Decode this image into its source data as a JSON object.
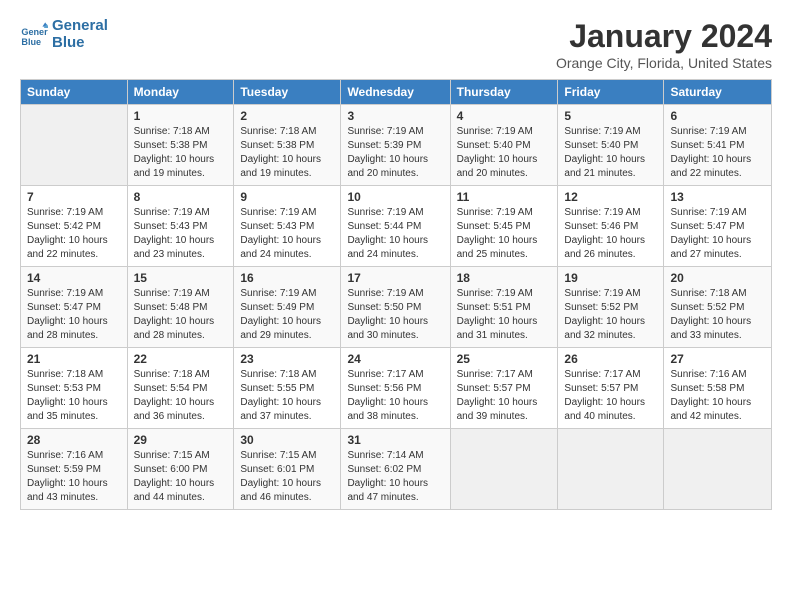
{
  "logo": {
    "text_general": "General",
    "text_blue": "Blue"
  },
  "title": "January 2024",
  "subtitle": "Orange City, Florida, United States",
  "days_of_week": [
    "Sunday",
    "Monday",
    "Tuesday",
    "Wednesday",
    "Thursday",
    "Friday",
    "Saturday"
  ],
  "weeks": [
    [
      {
        "day": "",
        "empty": true
      },
      {
        "day": "1",
        "sunrise": "7:18 AM",
        "sunset": "5:38 PM",
        "daylight": "10 hours and 19 minutes."
      },
      {
        "day": "2",
        "sunrise": "7:18 AM",
        "sunset": "5:38 PM",
        "daylight": "10 hours and 19 minutes."
      },
      {
        "day": "3",
        "sunrise": "7:19 AM",
        "sunset": "5:39 PM",
        "daylight": "10 hours and 20 minutes."
      },
      {
        "day": "4",
        "sunrise": "7:19 AM",
        "sunset": "5:40 PM",
        "daylight": "10 hours and 20 minutes."
      },
      {
        "day": "5",
        "sunrise": "7:19 AM",
        "sunset": "5:40 PM",
        "daylight": "10 hours and 21 minutes."
      },
      {
        "day": "6",
        "sunrise": "7:19 AM",
        "sunset": "5:41 PM",
        "daylight": "10 hours and 22 minutes."
      }
    ],
    [
      {
        "day": "7",
        "sunrise": "7:19 AM",
        "sunset": "5:42 PM",
        "daylight": "10 hours and 22 minutes."
      },
      {
        "day": "8",
        "sunrise": "7:19 AM",
        "sunset": "5:43 PM",
        "daylight": "10 hours and 23 minutes."
      },
      {
        "day": "9",
        "sunrise": "7:19 AM",
        "sunset": "5:43 PM",
        "daylight": "10 hours and 24 minutes."
      },
      {
        "day": "10",
        "sunrise": "7:19 AM",
        "sunset": "5:44 PM",
        "daylight": "10 hours and 24 minutes."
      },
      {
        "day": "11",
        "sunrise": "7:19 AM",
        "sunset": "5:45 PM",
        "daylight": "10 hours and 25 minutes."
      },
      {
        "day": "12",
        "sunrise": "7:19 AM",
        "sunset": "5:46 PM",
        "daylight": "10 hours and 26 minutes."
      },
      {
        "day": "13",
        "sunrise": "7:19 AM",
        "sunset": "5:47 PM",
        "daylight": "10 hours and 27 minutes."
      }
    ],
    [
      {
        "day": "14",
        "sunrise": "7:19 AM",
        "sunset": "5:47 PM",
        "daylight": "10 hours and 28 minutes."
      },
      {
        "day": "15",
        "sunrise": "7:19 AM",
        "sunset": "5:48 PM",
        "daylight": "10 hours and 28 minutes."
      },
      {
        "day": "16",
        "sunrise": "7:19 AM",
        "sunset": "5:49 PM",
        "daylight": "10 hours and 29 minutes."
      },
      {
        "day": "17",
        "sunrise": "7:19 AM",
        "sunset": "5:50 PM",
        "daylight": "10 hours and 30 minutes."
      },
      {
        "day": "18",
        "sunrise": "7:19 AM",
        "sunset": "5:51 PM",
        "daylight": "10 hours and 31 minutes."
      },
      {
        "day": "19",
        "sunrise": "7:19 AM",
        "sunset": "5:52 PM",
        "daylight": "10 hours and 32 minutes."
      },
      {
        "day": "20",
        "sunrise": "7:18 AM",
        "sunset": "5:52 PM",
        "daylight": "10 hours and 33 minutes."
      }
    ],
    [
      {
        "day": "21",
        "sunrise": "7:18 AM",
        "sunset": "5:53 PM",
        "daylight": "10 hours and 35 minutes."
      },
      {
        "day": "22",
        "sunrise": "7:18 AM",
        "sunset": "5:54 PM",
        "daylight": "10 hours and 36 minutes."
      },
      {
        "day": "23",
        "sunrise": "7:18 AM",
        "sunset": "5:55 PM",
        "daylight": "10 hours and 37 minutes."
      },
      {
        "day": "24",
        "sunrise": "7:17 AM",
        "sunset": "5:56 PM",
        "daylight": "10 hours and 38 minutes."
      },
      {
        "day": "25",
        "sunrise": "7:17 AM",
        "sunset": "5:57 PM",
        "daylight": "10 hours and 39 minutes."
      },
      {
        "day": "26",
        "sunrise": "7:17 AM",
        "sunset": "5:57 PM",
        "daylight": "10 hours and 40 minutes."
      },
      {
        "day": "27",
        "sunrise": "7:16 AM",
        "sunset": "5:58 PM",
        "daylight": "10 hours and 42 minutes."
      }
    ],
    [
      {
        "day": "28",
        "sunrise": "7:16 AM",
        "sunset": "5:59 PM",
        "daylight": "10 hours and 43 minutes."
      },
      {
        "day": "29",
        "sunrise": "7:15 AM",
        "sunset": "6:00 PM",
        "daylight": "10 hours and 44 minutes."
      },
      {
        "day": "30",
        "sunrise": "7:15 AM",
        "sunset": "6:01 PM",
        "daylight": "10 hours and 46 minutes."
      },
      {
        "day": "31",
        "sunrise": "7:14 AM",
        "sunset": "6:02 PM",
        "daylight": "10 hours and 47 minutes."
      },
      {
        "day": "",
        "empty": true
      },
      {
        "day": "",
        "empty": true
      },
      {
        "day": "",
        "empty": true
      }
    ]
  ]
}
